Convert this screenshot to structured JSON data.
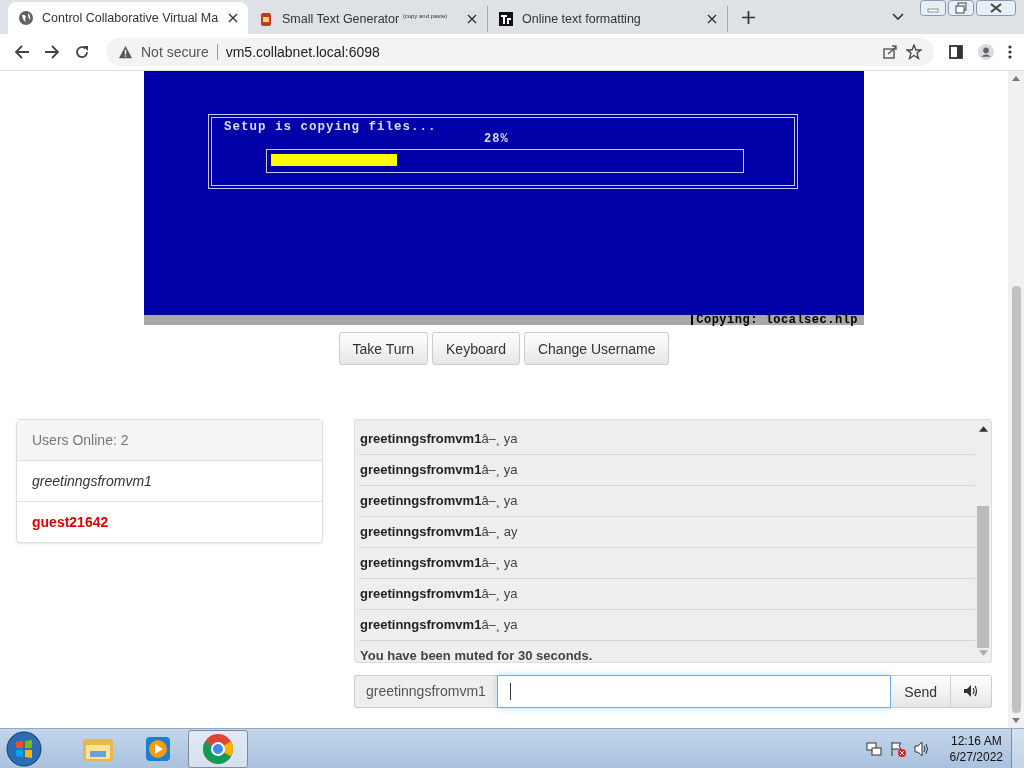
{
  "browser": {
    "tabs": [
      {
        "title": "Control Collaborative Virtual Ma",
        "selected": true
      },
      {
        "title": "Small Text Generator $^{(copy and paste)}$",
        "selected": false
      },
      {
        "title": "Online text formatting",
        "selected": false
      }
    ],
    "security": "Not secure",
    "url": "vm5.collabnet.local:6098"
  },
  "vm_screen": {
    "heading": "Setup is copying files...",
    "percent": "28%",
    "level": 0.27,
    "status": "Copying: localsec.hlp"
  },
  "vm_buttons": [
    "Take Turn",
    "Keyboard",
    "Change Username"
  ],
  "users": {
    "header": "Users Online: 2",
    "items": [
      {
        "name": "greetinngsfromvm1",
        "kind": "self",
        "color": "#333333"
      },
      {
        "name": "guest21642",
        "kind": "guest",
        "color": "#dd0000"
      }
    ]
  },
  "chat": {
    "messages": [
      {
        "text": "**greetinngsfromvm1**â–¸ ya",
        "kind": "user"
      },
      {
        "text": "**greetinngsfromvm1**â–¸ ya",
        "kind": "user"
      },
      {
        "text": "**greetinngsfromvm1**â–¸ ya",
        "kind": "user"
      },
      {
        "text": "**greetinngsfromvm1**â–¸ ay",
        "kind": "user"
      },
      {
        "text": "**greetinngsfromvm1**â–¸ ya",
        "kind": "user"
      },
      {
        "text": "**greetinngsfromvm1**â–¸ ya",
        "kind": "user"
      },
      {
        "text": "**greetinngsfromvm1**â–¸ ya",
        "kind": "user"
      },
      {
        "text": "You have been muted for 30 seconds.",
        "kind": "system"
      }
    ],
    "username": "greetinngsfromvm1",
    "send": "Send"
  },
  "taskbar": {
    "apps": [
      {
        "selected": false
      },
      {
        "selected": false
      },
      {
        "selected": true
      }
    ],
    "time": "12:16 AM",
    "date": "6/27/2022"
  }
}
